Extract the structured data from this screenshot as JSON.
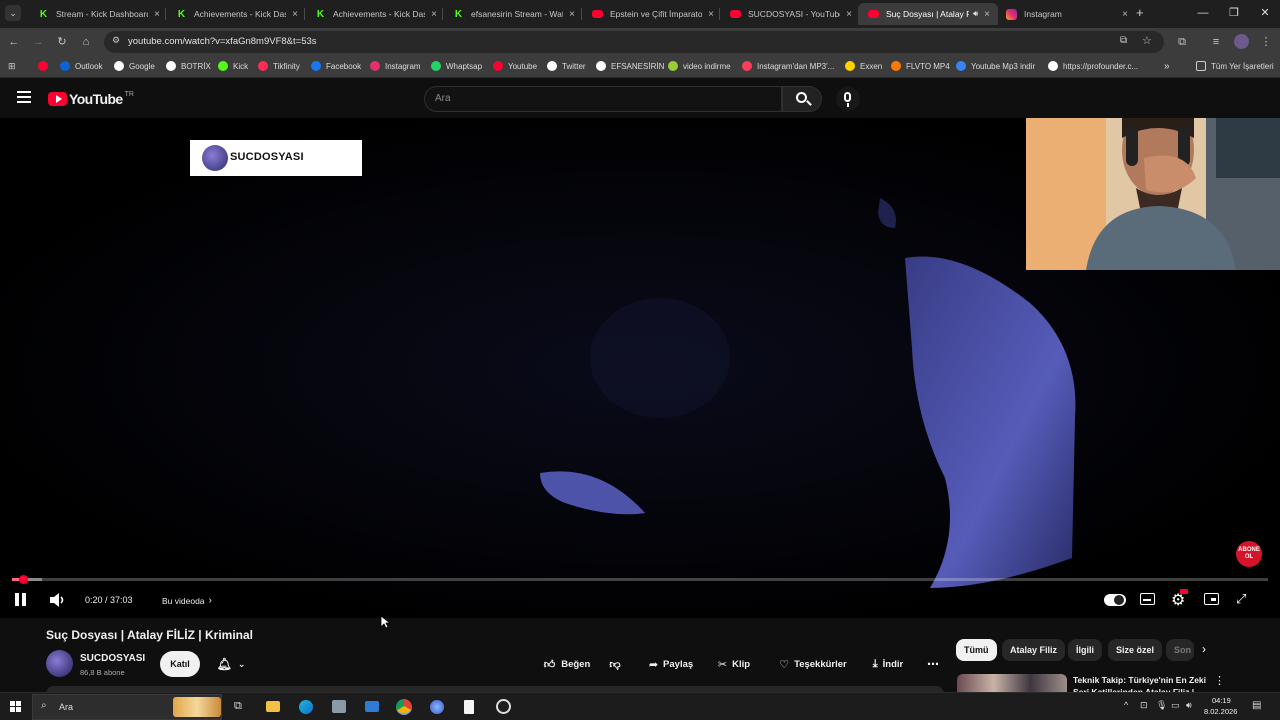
{
  "browser": {
    "tabs": [
      {
        "title": "Stream - Kick Dashboard",
        "favicon": "kick-icon",
        "color": "#53fc18",
        "active": false
      },
      {
        "title": "Achievements - Kick Dash",
        "favicon": "kick-icon",
        "color": "#53fc18",
        "active": false
      },
      {
        "title": "Achievements - Kick Dash",
        "favicon": "kick-icon",
        "color": "#53fc18",
        "active": false
      },
      {
        "title": "efsanesirin Stream - Watc",
        "favicon": "kick-icon",
        "color": "#53fc18",
        "active": false
      },
      {
        "title": "Epstein ve Çifit İmparatorl",
        "favicon": "youtube-icon",
        "color": "#ff0033",
        "active": false
      },
      {
        "title": "SUCDOSYASI - YouTube",
        "favicon": "youtube-icon",
        "color": "#ff0033",
        "active": false
      },
      {
        "title": "Suç Dosyası | Atalay F",
        "favicon": "youtube-icon",
        "color": "#ff0033",
        "active": true
      },
      {
        "title": "Instagram",
        "favicon": "instagram-icon",
        "color": "#e1306c",
        "active": false
      }
    ],
    "url": "youtube.com/watch?v=xfaGn8m9VF8&t=53s",
    "bookmarks": [
      {
        "label": "",
        "color": "#ff0033"
      },
      {
        "label": "Outlook",
        "color": "#0a64d6"
      },
      {
        "label": "Google",
        "color": "#ffffff"
      },
      {
        "label": "BOTRİX",
        "color": "#ffffff"
      },
      {
        "label": "Kick",
        "color": "#53fc18"
      },
      {
        "label": "Tikfinity",
        "color": "#ff2d55"
      },
      {
        "label": "Facebook",
        "color": "#1877f2"
      },
      {
        "label": "Instagram",
        "color": "#e1306c"
      },
      {
        "label": "Whaptsap",
        "color": "#25d366"
      },
      {
        "label": "Youtube",
        "color": "#ff0033"
      },
      {
        "label": "Twitter",
        "color": "#ffffff"
      },
      {
        "label": "EFSANESİRİN",
        "color": "#ffffff"
      },
      {
        "label": "video indirme",
        "color": "#9acd32"
      },
      {
        "label": "Instagram'dan MP3'...",
        "color": "#ff3d5a"
      },
      {
        "label": "Exxen",
        "color": "#ffd200"
      },
      {
        "label": "FLVTO MP4",
        "color": "#ff7a00"
      },
      {
        "label": "Youtube Mp3 indir",
        "color": "#3b82f6"
      },
      {
        "label": "https://profounder.c...",
        "color": "#ffffff"
      }
    ],
    "all_bookmarks": "Tüm Yer İşaretleri",
    "more": "»"
  },
  "youtube": {
    "logo_text": "YouTube",
    "region": "TR",
    "search_placeholder": "Ara",
    "overlay_channel": "SUCDOSYASI",
    "subscribe_badge": "ABONE\nOL",
    "player": {
      "time": "0:20 / 37:03",
      "chapter": "Bu videoda",
      "progress": 0.009
    },
    "video": {
      "title": "Suç Dosyası | Atalay FİLİZ | Kriminal",
      "channel": "SUCDOSYASI",
      "subscribers": "86,8 B abone",
      "join": "Katıl",
      "actions": {
        "like": "Beğen",
        "share": "Paylaş",
        "clip": "Klip",
        "thanks": "Teşekkürler",
        "download": "İndir"
      }
    },
    "chips": [
      "Tümü",
      "Atalay Filiz",
      "İlgili",
      "Size özel",
      "Son"
    ],
    "next_video": {
      "title_line1": "Teknik Takip: Türkiye'nin En Zeki",
      "title_line2": "Seri Katillerinden Atalay Filiz |"
    }
  },
  "taskbar": {
    "search": "Ara",
    "time": "04:19",
    "date": "8.02.2026"
  }
}
